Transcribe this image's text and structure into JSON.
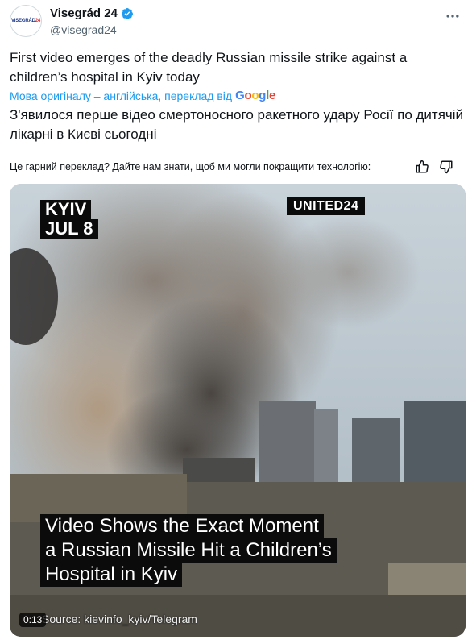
{
  "tweet": {
    "author": {
      "display_name": "Visegrád 24",
      "handle": "@visegrad24",
      "avatar_text_main": "VISEGRÁD",
      "avatar_text_accent": "24"
    },
    "text_en": "First video emerges of the deadly Russian missile strike against a children’s hospital in Kyiv today",
    "translation_link": "Мова оригіналу – англійська, переклад від",
    "translation_provider": "Google",
    "text_uk": "З'явилося перше відео смертоносного ракетного удару Росії по дитячій лікарні в Києві сьогодні",
    "feedback_prompt": "Це гарний переклад? Дайте нам знати, щоб ми могли покращити технологію:",
    "media": {
      "overlay_city": "KYIV",
      "overlay_date": "JUL 8",
      "overlay_brand": "UNITED24",
      "caption_line1": "Video Shows the Exact Moment",
      "caption_line2": "a Russian Missile Hit a Children’s",
      "caption_line3": "Hospital in Kyiv",
      "source": "Source: kievinfo_kyiv/Telegram",
      "timestamp": "0:13"
    }
  },
  "colors": {
    "link": "#1d9bf0",
    "verified": "#1d9bf0",
    "text": "#0f1419",
    "muted": "#536471"
  },
  "icons": [
    "verified-badge-icon",
    "more-options-icon",
    "thumbs-up-icon",
    "thumbs-down-icon"
  ]
}
